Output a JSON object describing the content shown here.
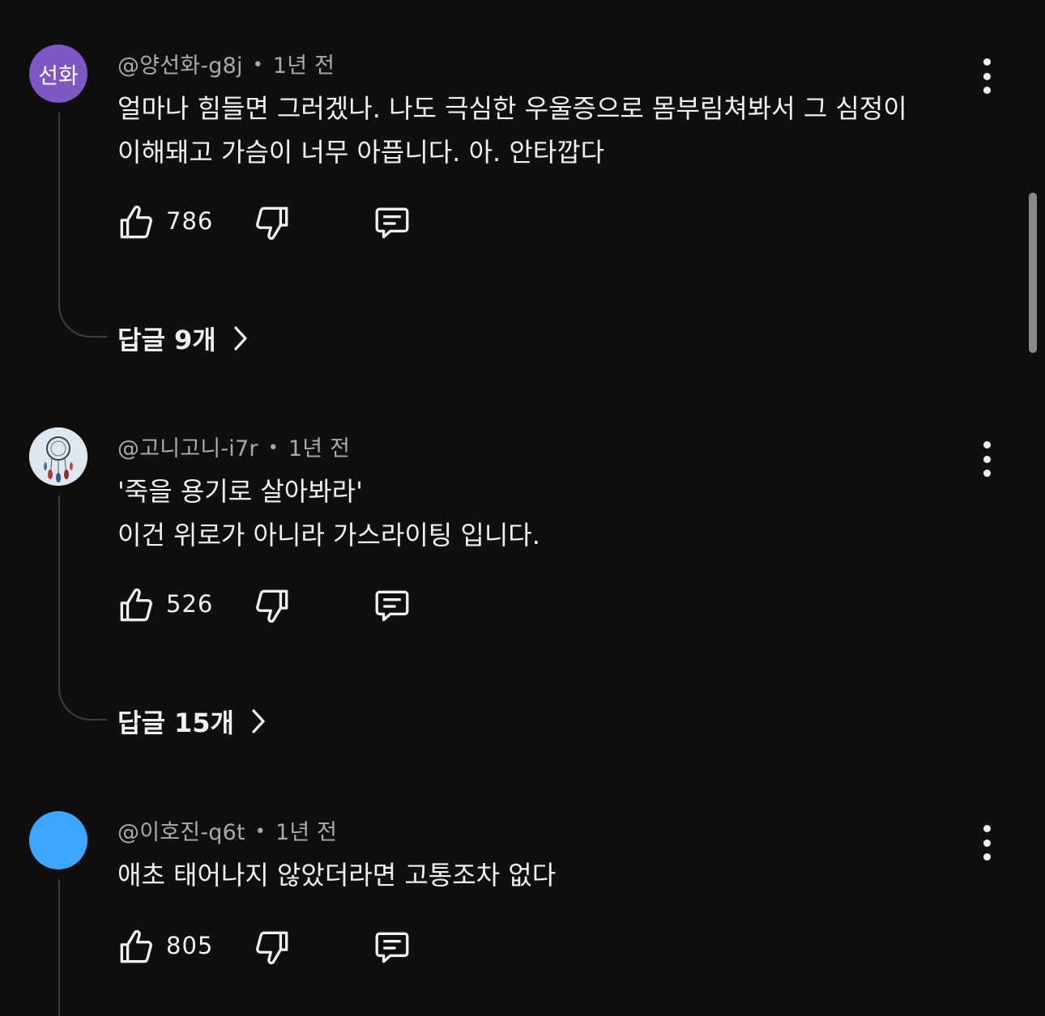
{
  "comments": [
    {
      "avatar_text": "선화",
      "avatar_color": "#7e57c2",
      "handle": "@양선화-g8j",
      "time": "1년 전",
      "lines": [
        "얼마나 힘들면 그러겠나. 나도 극심한 우울증으로 몸부림쳐봐서 그 심정이",
        "이해돼고 가슴이 너무 아픕니다. 아. 안타깝다"
      ],
      "likes": "786",
      "replies": "답글 9개"
    },
    {
      "avatar_text": "",
      "avatar_color": "#d9e4ea",
      "avatar_image": "dreamcatcher-image",
      "handle": "@고니고니-i7r",
      "time": "1년 전",
      "lines": [
        "'죽을 용기로 살아봐라'",
        "이건 위로가 아니라 가스라이팅 입니다."
      ],
      "likes": "526",
      "replies": "답글 15개"
    },
    {
      "avatar_text": "",
      "avatar_color": "#3ea6ff",
      "handle": "@이호진-q6t",
      "time": "1년 전",
      "lines": [
        "애초 태어나지 않았더라면 고통조차 없다"
      ],
      "likes": "805",
      "replies": ""
    }
  ],
  "icons": {
    "like": "thumbs-up-icon",
    "dislike": "thumbs-down-icon",
    "reply": "comment-reply-icon",
    "more": "more-vertical-icon",
    "chevron": "chevron-right-icon"
  },
  "theme": {
    "background": "#0f0f0f",
    "text": "#f1f1f1",
    "secondary_text": "#aaaaaa"
  }
}
